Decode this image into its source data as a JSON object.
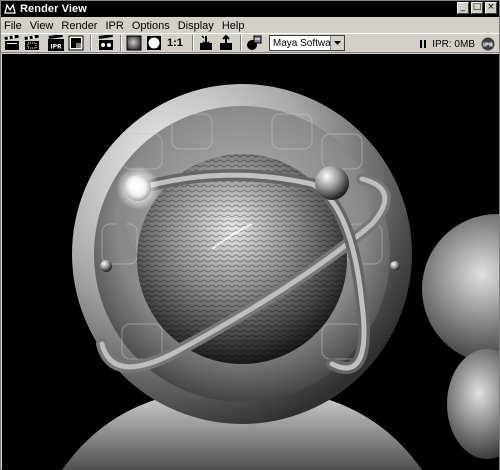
{
  "window": {
    "title": "Render View"
  },
  "menu": [
    "File",
    "View",
    "Render",
    "IPR",
    "Options",
    "Display",
    "Help"
  ],
  "toolbar": {
    "ratio_label": "1:1",
    "renderer": "Maya Software",
    "ipr_status": "IPR: 0MB",
    "ipr_badge": "IPR",
    "tool_ipr_label": "IPR"
  },
  "icons": {
    "redo-render": "clapboard-icon",
    "render-region": "clapboard-region-icon",
    "ipr-render": "ipr-icon",
    "snapshot": "snapshot-icon",
    "render-settings": "settings-icon",
    "rgb": "gray-square-icon",
    "alpha": "white-circle-icon",
    "keep-image": "keep-image-icon",
    "remove-image": "remove-image-icon",
    "render-globals": "globals-icon",
    "pause": "pause-icon",
    "ipr-indicator": "ipr-badge-icon"
  }
}
